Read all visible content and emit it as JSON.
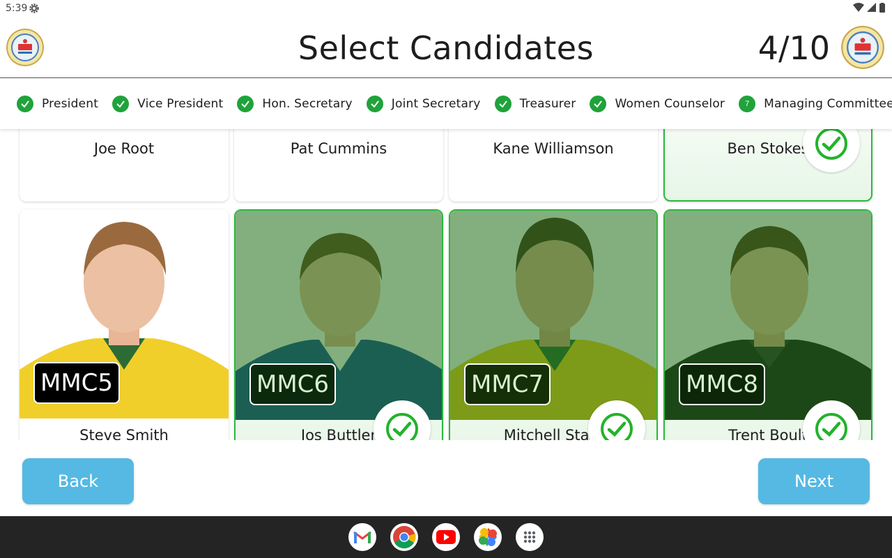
{
  "status_bar": {
    "time": "5:39"
  },
  "header": {
    "title": "Select Candidates",
    "counter": "4/10"
  },
  "stepper": {
    "steps": [
      {
        "label": "President",
        "state": "done"
      },
      {
        "label": "Vice President",
        "state": "done"
      },
      {
        "label": "Hon. Secretary",
        "state": "done"
      },
      {
        "label": "Joint Secretary",
        "state": "done"
      },
      {
        "label": "Treasurer",
        "state": "done"
      },
      {
        "label": "Women Counselor",
        "state": "done"
      },
      {
        "label": "Managing Committee",
        "state": "current",
        "number": "7"
      }
    ]
  },
  "candidates_top": [
    {
      "name": "Joe Root",
      "selected": false
    },
    {
      "name": "Pat Cummins",
      "selected": false
    },
    {
      "name": "Kane Williamson",
      "selected": false
    },
    {
      "name": "Ben Stokes",
      "selected": true
    }
  ],
  "candidates_bottom": [
    {
      "code": "MMC5",
      "name": "Steve Smith",
      "selected": false,
      "jersey": "#f1cf2a"
    },
    {
      "code": "MMC6",
      "name": "Jos Buttler",
      "selected": true,
      "jersey": "#1a4fa0"
    },
    {
      "code": "MMC7",
      "name": "Mitchell Starc",
      "selected": true,
      "jersey": "#f1d21e"
    },
    {
      "code": "MMC8",
      "name": "Trent Boult",
      "selected": true,
      "jersey": "#1b1b1b"
    }
  ],
  "footer": {
    "back_label": "Back",
    "next_label": "Next"
  },
  "taskbar": {
    "apps": [
      "gmail-icon",
      "chrome-icon",
      "youtube-icon",
      "photos-icon",
      "app-drawer-icon"
    ]
  },
  "colors": {
    "accent_green": "#1fa33a",
    "button_blue": "#55b9e3"
  }
}
